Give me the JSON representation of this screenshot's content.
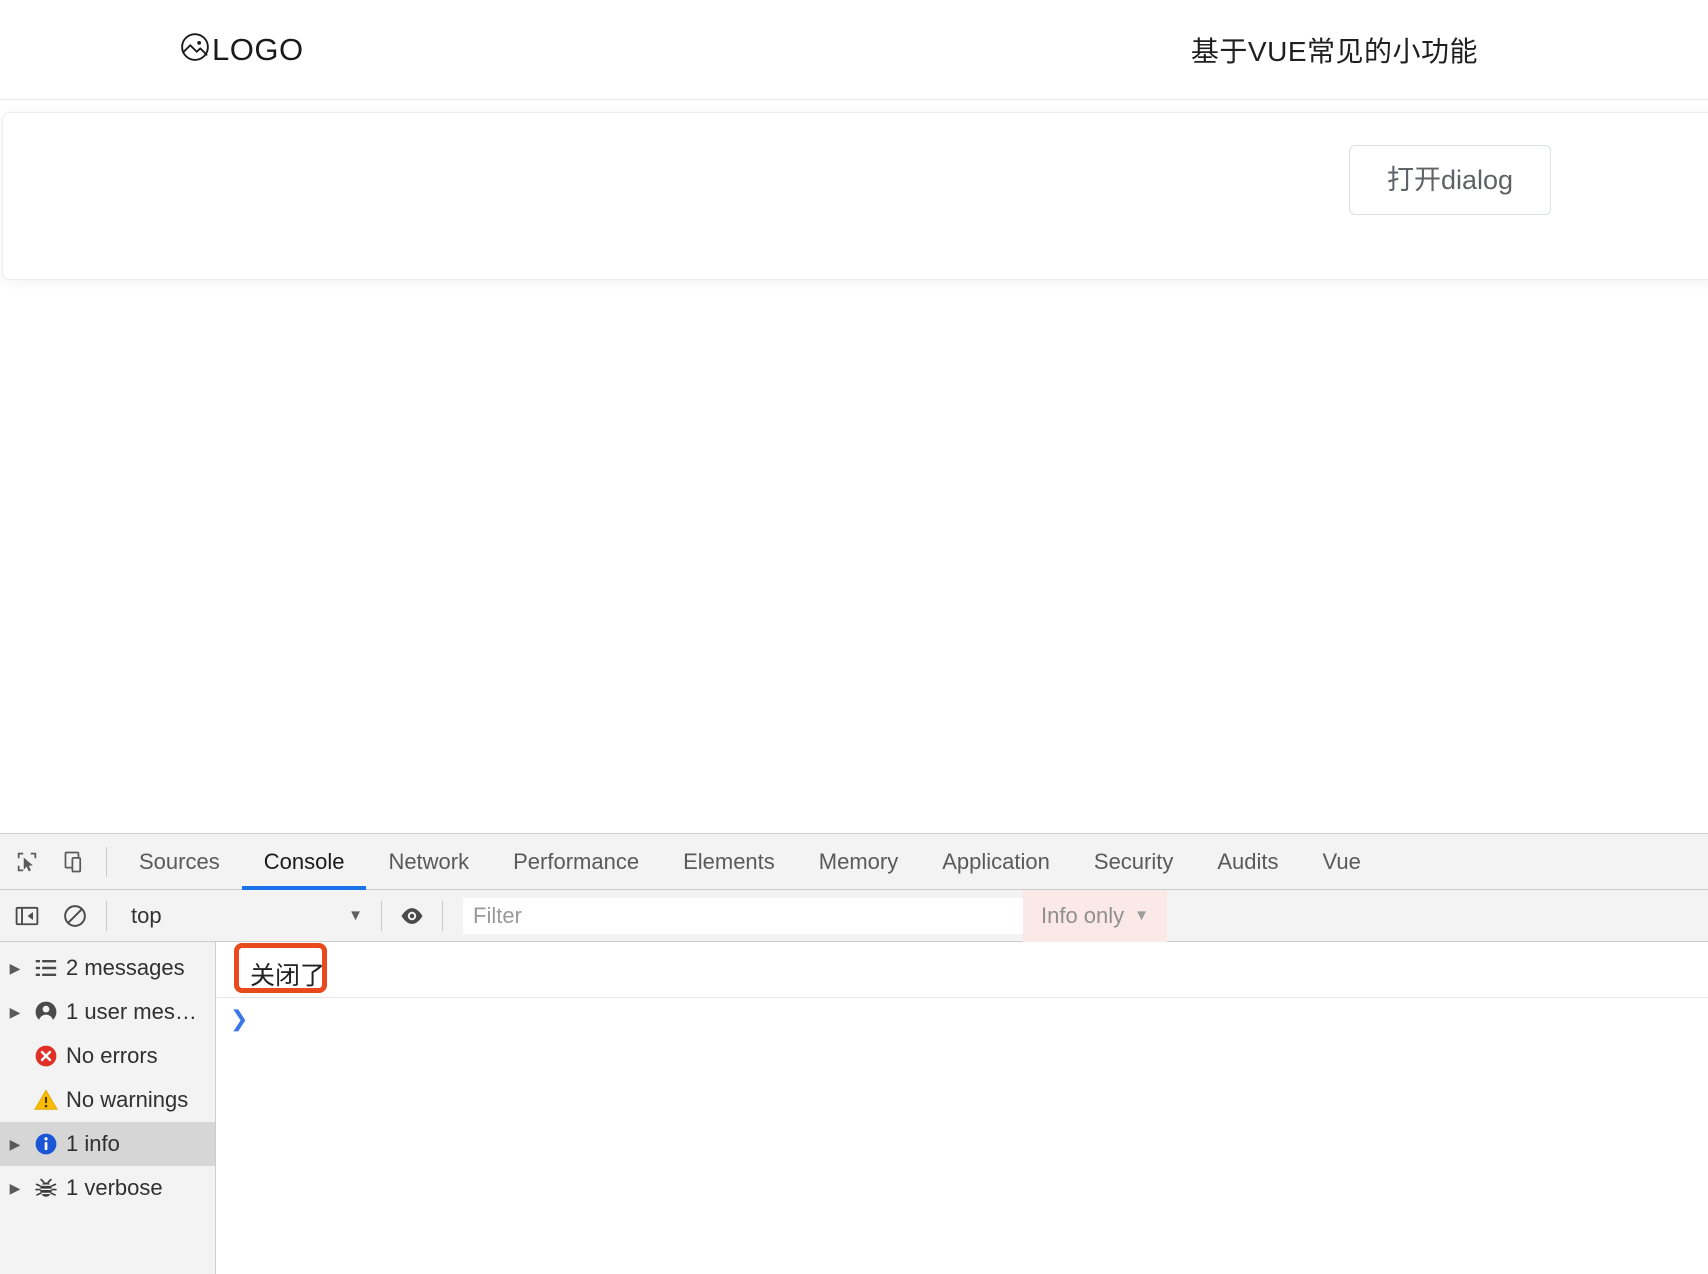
{
  "header": {
    "logo_text": "LOGO",
    "logo_icon": "image-circle-icon",
    "title": "基于VUE常见的小功能"
  },
  "main": {
    "open_dialog_button": "打开dialog"
  },
  "devtools": {
    "icons": {
      "inspect": "inspect-cursor-icon",
      "device": "device-toolbar-icon",
      "sidebar_toggle": "console-sidebar-toggle-icon",
      "clear": "clear-console-icon",
      "eye": "eye-icon",
      "caret": "▼"
    },
    "tabs": [
      {
        "label": "Sources",
        "active": false
      },
      {
        "label": "Console",
        "active": true
      },
      {
        "label": "Network",
        "active": false
      },
      {
        "label": "Performance",
        "active": false
      },
      {
        "label": "Elements",
        "active": false
      },
      {
        "label": "Memory",
        "active": false
      },
      {
        "label": "Application",
        "active": false
      },
      {
        "label": "Security",
        "active": false
      },
      {
        "label": "Audits",
        "active": false
      },
      {
        "label": "Vue",
        "active": false
      }
    ],
    "toolbar": {
      "context": "top",
      "filter_placeholder": "Filter",
      "filter_value": "",
      "level": "Info only"
    },
    "sidebar": [
      {
        "label": "2 messages",
        "icon": "list-icon",
        "expandable": true,
        "selected": false
      },
      {
        "label": "1 user mes…",
        "icon": "person-icon",
        "expandable": true,
        "selected": false
      },
      {
        "label": "No errors",
        "icon": "error-icon",
        "expandable": false,
        "selected": false
      },
      {
        "label": "No warnings",
        "icon": "warning-icon",
        "expandable": false,
        "selected": false
      },
      {
        "label": "1 info",
        "icon": "info-icon",
        "expandable": true,
        "selected": true
      },
      {
        "label": "1 verbose",
        "icon": "bug-icon",
        "expandable": true,
        "selected": false
      }
    ],
    "console_message": "关闭了",
    "prompt_symbol": "❯",
    "annotation_color": "#e8491d",
    "accent_color": "#1a73e8"
  }
}
